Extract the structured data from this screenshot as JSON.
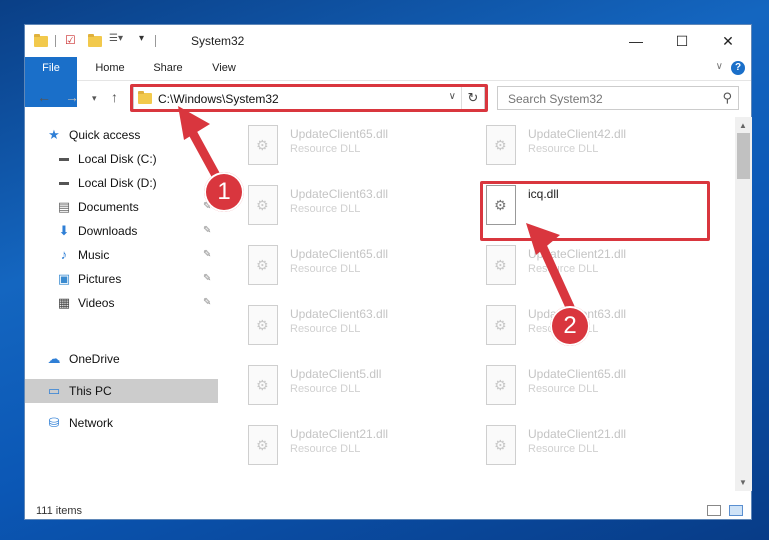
{
  "window": {
    "title": "System32"
  },
  "controls": {
    "minimize": "—",
    "maximize": "☐",
    "close": "✕"
  },
  "ribbon": {
    "tabs": [
      "File",
      "Home",
      "Share",
      "View"
    ],
    "help": "?"
  },
  "address": {
    "path": "C:\\Windows\\System32"
  },
  "search": {
    "placeholder": "Search System32"
  },
  "sidebar": {
    "items": [
      {
        "label": "Quick access",
        "icon": "star-icon"
      },
      {
        "label": "Local Disk (C:)",
        "icon": "drive-icon"
      },
      {
        "label": "Local Disk (D:)",
        "icon": "drive-icon"
      },
      {
        "label": "Documents",
        "icon": "document-icon"
      },
      {
        "label": "Downloads",
        "icon": "download-icon"
      },
      {
        "label": "Music",
        "icon": "music-icon"
      },
      {
        "label": "Pictures",
        "icon": "picture-icon"
      },
      {
        "label": "Videos",
        "icon": "video-icon"
      },
      {
        "label": "OneDrive",
        "icon": "cloud-icon"
      },
      {
        "label": "This PC",
        "icon": "computer-icon"
      },
      {
        "label": "Network",
        "icon": "network-icon"
      }
    ]
  },
  "files": [
    {
      "name": "UpdateClient65.dll",
      "type": "Resource DLL"
    },
    {
      "name": "UpdateClient42.dll",
      "type": "Resource DLL"
    },
    {
      "name": "UpdateClient63.dll",
      "type": "Resource DLL"
    },
    {
      "name": "icq.dll",
      "type": ""
    },
    {
      "name": "UpdateClient65.dll",
      "type": "Resource DLL"
    },
    {
      "name": "UpdateClient21.dll",
      "type": "Resource DLL"
    },
    {
      "name": "UpdateClient63.dll",
      "type": "Resource DLL"
    },
    {
      "name": "UpdateClient63.dll",
      "type": "Resource DLL"
    },
    {
      "name": "UpdateClient5.dll",
      "type": "Resource DLL"
    },
    {
      "name": "UpdateClient65.dll",
      "type": "Resource DLL"
    },
    {
      "name": "UpdateClient21.dll",
      "type": "Resource DLL"
    },
    {
      "name": "UpdateClient21.dll",
      "type": "Resource DLL"
    }
  ],
  "status": {
    "count": "111 items"
  },
  "callouts": {
    "step1": "1",
    "step2": "2"
  },
  "colors": {
    "accent": "#1a6fc9",
    "highlight": "#d9363e"
  }
}
